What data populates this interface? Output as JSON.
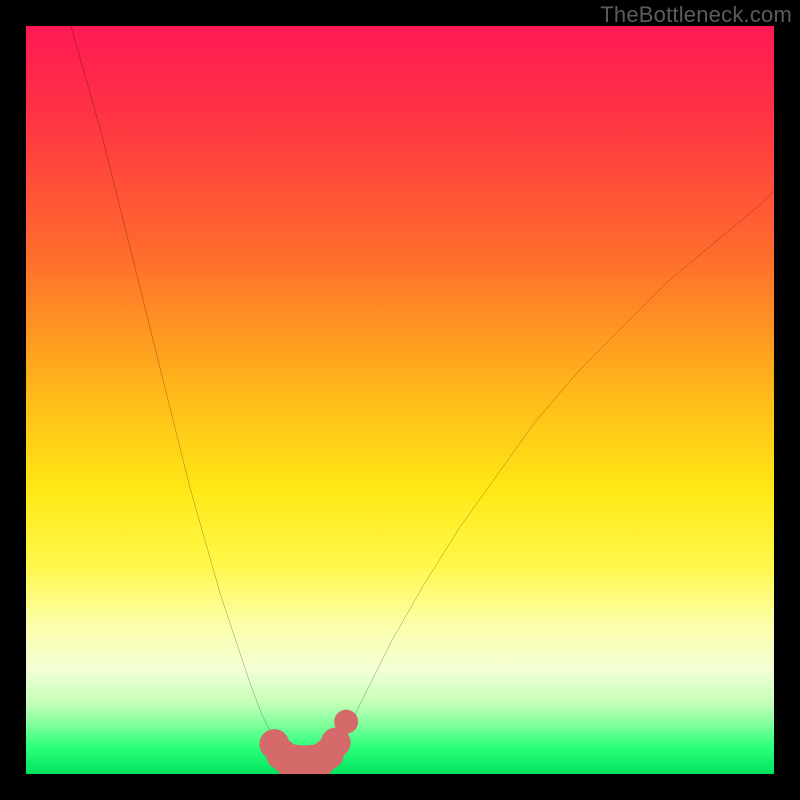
{
  "watermark": "TheBottleneck.com",
  "chart_data": {
    "type": "line",
    "title": "",
    "xlabel": "",
    "ylabel": "",
    "xlim": [
      0,
      100
    ],
    "ylim": [
      0,
      100
    ],
    "grid": false,
    "legend": false,
    "background_gradient": {
      "stops": [
        {
          "offset": 0.0,
          "color": "#ff1a55"
        },
        {
          "offset": 0.12,
          "color": "#ff3344"
        },
        {
          "offset": 0.3,
          "color": "#ff6a2d"
        },
        {
          "offset": 0.48,
          "color": "#ffb41a"
        },
        {
          "offset": 0.62,
          "color": "#ffe815"
        },
        {
          "offset": 0.72,
          "color": "#fff74a"
        },
        {
          "offset": 0.8,
          "color": "#fcffa8"
        },
        {
          "offset": 0.86,
          "color": "#f3ffd6"
        },
        {
          "offset": 0.905,
          "color": "#c6ffb8"
        },
        {
          "offset": 0.935,
          "color": "#7bff9a"
        },
        {
          "offset": 0.965,
          "color": "#2bff7a"
        },
        {
          "offset": 1.0,
          "color": "#00e35e"
        }
      ]
    },
    "series": [
      {
        "name": "left-branch",
        "stroke": "#000000",
        "stroke_width": 1.6,
        "x": [
          6,
          8,
          10,
          12,
          14,
          16,
          18,
          20,
          22,
          24,
          26,
          28,
          30,
          31.5,
          33,
          34,
          35
        ],
        "y": [
          100,
          93,
          86,
          78,
          70,
          62,
          54,
          46,
          38,
          31,
          24,
          18,
          12,
          8,
          5,
          3,
          2
        ]
      },
      {
        "name": "right-branch",
        "stroke": "#000000",
        "stroke_width": 1.6,
        "x": [
          40,
          41,
          42.5,
          44,
          46,
          49,
          53,
          58,
          63,
          68,
          74,
          80,
          86,
          92,
          98,
          100
        ],
        "y": [
          2,
          3,
          5,
          8,
          12,
          18,
          25,
          33,
          40,
          47,
          54,
          60,
          66,
          71,
          76,
          78
        ]
      },
      {
        "name": "valley-floor",
        "stroke": "#000000",
        "stroke_width": 1.6,
        "x": [
          35,
          36.5,
          38,
          40
        ],
        "y": [
          2,
          1.6,
          1.6,
          2
        ]
      }
    ],
    "markers": {
      "name": "valley-markers",
      "color": "#d46a6a",
      "x": [
        33.2,
        34.2,
        35.2,
        36.5,
        38.0,
        39.3,
        40.4,
        41.4,
        42.8
      ],
      "y": [
        4.0,
        2.6,
        1.9,
        1.6,
        1.6,
        1.9,
        2.7,
        4.2,
        7.0
      ],
      "r": [
        2.0,
        2.1,
        2.2,
        2.3,
        2.3,
        2.2,
        2.1,
        2.0,
        1.6
      ]
    }
  }
}
